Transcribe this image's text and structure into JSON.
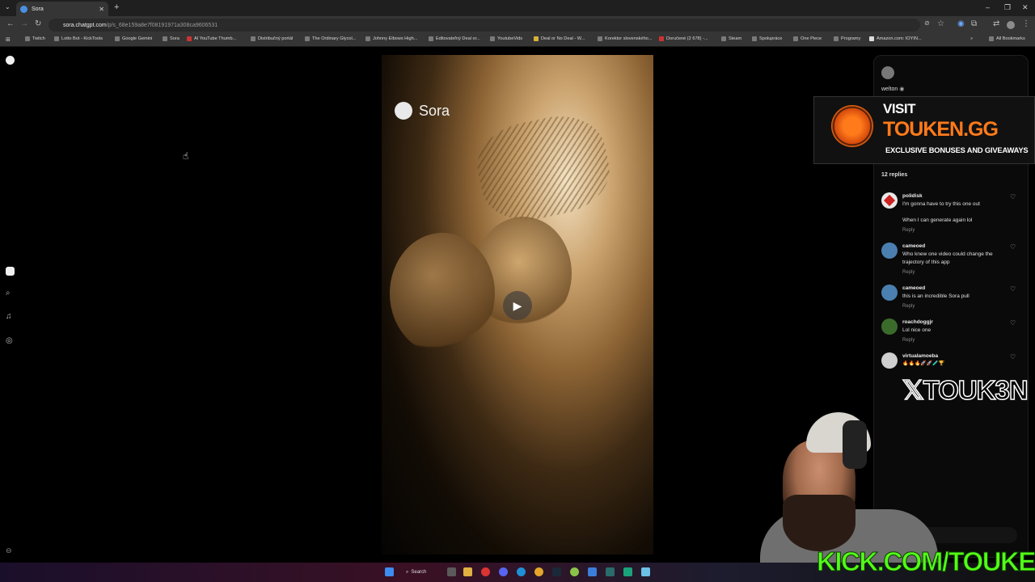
{
  "browser": {
    "tab_title": "Sora",
    "url_host": "sora.chatgpt.com",
    "url_path": "/p/s_68e159a8e7f08191971a308ca9606531",
    "bookmarks": [
      "Twitch",
      "Lotto Bot - KickTools",
      "Google Gemini",
      "Sora",
      "AI YouTube Thumb...",
      "Distribučný portál",
      "The Ordinary Glycol...",
      "Johnny Elbows High...",
      "Editovateľný Deal or...",
      "YoutubeVids",
      "Deal or No Deal - W...",
      "Korektor slovenského...",
      "Doručené (2 678) -...",
      "Steam",
      "Spolupráce",
      "One Piece",
      "Programy",
      "Amazon.com: IOYIN..."
    ],
    "all_bookmarks": "All Bookmarks"
  },
  "video": {
    "brand": "Sora"
  },
  "post": {
    "author": "welton",
    "replies_count": "12 replies",
    "reply_label": "Reply",
    "comments": [
      {
        "user": "polidisk",
        "text": "I'm gonna have to try this one out",
        "text2": "When I can generate again lol",
        "avatar_color": "#e8e8e8"
      },
      {
        "user": "cameoed",
        "text": "Who knew one video could change the trajectory of this app",
        "avatar_color": "#4a7fb0"
      },
      {
        "user": "cameoed",
        "text": "this is an incredible Sora pull",
        "avatar_color": "#4a7fb0"
      },
      {
        "user": "roachdoggjr",
        "text": "Lol nice one",
        "avatar_color": "#3b6b2a"
      },
      {
        "user": "virtualamoeba",
        "text": "🔥🔥🔥🚀🚀🧪🏆",
        "avatar_color": "#cfcfcf"
      }
    ]
  },
  "overlay": {
    "visit": "VISIT",
    "site": "TOUKEN.GG",
    "tagline": "EXCLUSIVE BONUSES AND GIVEAWAYS",
    "x_handle": "𝕏TOUK3N",
    "kick": "KICK.COM/TOUKEN"
  },
  "taskbar": {
    "search_label": "Search"
  }
}
